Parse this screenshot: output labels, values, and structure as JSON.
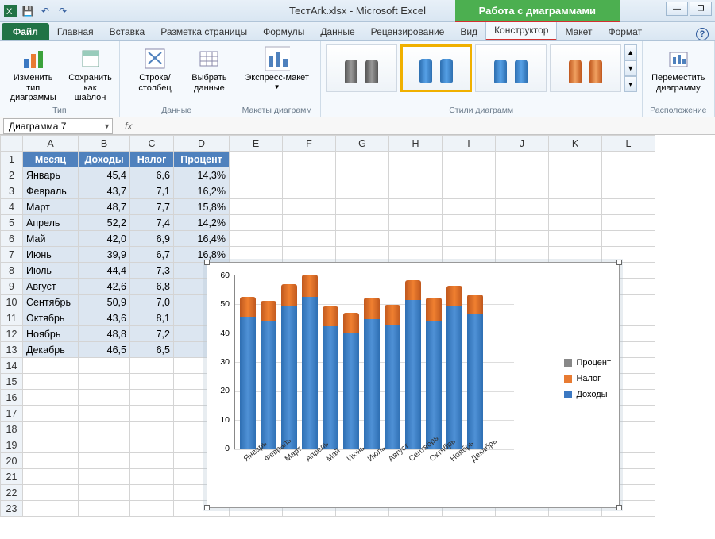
{
  "title": "ТестArk.xlsx - Microsoft Excel",
  "chart_tools_label": "Работа с диаграммами",
  "window": {
    "minimize": "—",
    "restore": "❐"
  },
  "tabs": {
    "file": "Файл",
    "items": [
      "Главная",
      "Вставка",
      "Разметка страницы",
      "Формулы",
      "Данные",
      "Рецензирование",
      "Вид",
      "Конструктор",
      "Макет",
      "Формат"
    ]
  },
  "ribbon": {
    "type_group": "Тип",
    "change_type": "Изменить тип\nдиаграммы",
    "save_template": "Сохранить\nкак шаблон",
    "data_group": "Данные",
    "switch_row_col": "Строка/столбец",
    "select_data": "Выбрать\nданные",
    "layout_group": "Макеты диаграмм",
    "express_layout": "Экспресс-макет",
    "styles_group": "Стили диаграмм",
    "location_group": "Расположение",
    "move_chart": "Переместить\nдиаграмму"
  },
  "name_box": "Диаграмма 7",
  "fx": "fx",
  "columns": [
    "A",
    "B",
    "C",
    "D",
    "E",
    "F",
    "G",
    "H",
    "I",
    "J",
    "K",
    "L"
  ],
  "headers": {
    "month": "Месяц",
    "income": "Доходы",
    "tax": "Налог",
    "percent": "Процент"
  },
  "rows": [
    {
      "n": 1
    },
    {
      "n": 2,
      "m": "Январь",
      "i": "45,4",
      "t": "6,6",
      "p": "14,3%"
    },
    {
      "n": 3,
      "m": "Февраль",
      "i": "43,7",
      "t": "7,1",
      "p": "16,2%"
    },
    {
      "n": 4,
      "m": "Март",
      "i": "48,7",
      "t": "7,7",
      "p": "15,8%"
    },
    {
      "n": 5,
      "m": "Апрель",
      "i": "52,2",
      "t": "7,4",
      "p": "14,2%"
    },
    {
      "n": 6,
      "m": "Май",
      "i": "42,0",
      "t": "6,9",
      "p": "16,4%"
    },
    {
      "n": 7,
      "m": "Июнь",
      "i": "39,9",
      "t": "6,7",
      "p": "16,8%"
    },
    {
      "n": 8,
      "m": "Июль",
      "i": "44,4",
      "t": "7,3",
      "p": ""
    },
    {
      "n": 9,
      "m": "Август",
      "i": "42,6",
      "t": "6,8",
      "p": ""
    },
    {
      "n": 10,
      "m": "Сентябрь",
      "i": "50,9",
      "t": "7,0",
      "p": ""
    },
    {
      "n": 11,
      "m": "Октябрь",
      "i": "43,6",
      "t": "8,1",
      "p": ""
    },
    {
      "n": 12,
      "m": "Ноябрь",
      "i": "48,8",
      "t": "7,2",
      "p": ""
    },
    {
      "n": 13,
      "m": "Декабрь",
      "i": "46,5",
      "t": "6,5",
      "p": ""
    }
  ],
  "extra_rows": [
    14,
    15,
    16,
    17,
    18,
    19,
    20,
    21,
    22,
    23
  ],
  "legend": {
    "percent": "Процент",
    "tax": "Налог",
    "income": "Доходы"
  },
  "y_ticks": [
    "60",
    "50",
    "40",
    "30",
    "20",
    "10",
    "0"
  ],
  "chart_data": {
    "type": "bar",
    "stacked": true,
    "categories": [
      "Январь",
      "Февраль",
      "Март",
      "Апрель",
      "Май",
      "Июнь",
      "Июль",
      "Август",
      "Сентябрь",
      "Октябрь",
      "Ноябрь",
      "Декабрь"
    ],
    "series": [
      {
        "name": "Доходы",
        "values": [
          45.4,
          43.7,
          48.7,
          52.2,
          42.0,
          39.9,
          44.4,
          42.6,
          50.9,
          43.6,
          48.8,
          46.5
        ],
        "color": "#3b78c2"
      },
      {
        "name": "Налог",
        "values": [
          6.6,
          7.1,
          7.7,
          7.4,
          6.9,
          6.7,
          7.3,
          6.8,
          7.0,
          8.1,
          7.2,
          6.5
        ],
        "color": "#e87b32"
      },
      {
        "name": "Процент",
        "values": [
          14.3,
          16.2,
          15.8,
          14.2,
          16.4,
          16.8,
          null,
          null,
          null,
          null,
          null,
          null
        ],
        "color": "#888888"
      }
    ],
    "ylim": [
      0,
      60
    ],
    "xlabel": "",
    "ylabel": "",
    "title": ""
  }
}
